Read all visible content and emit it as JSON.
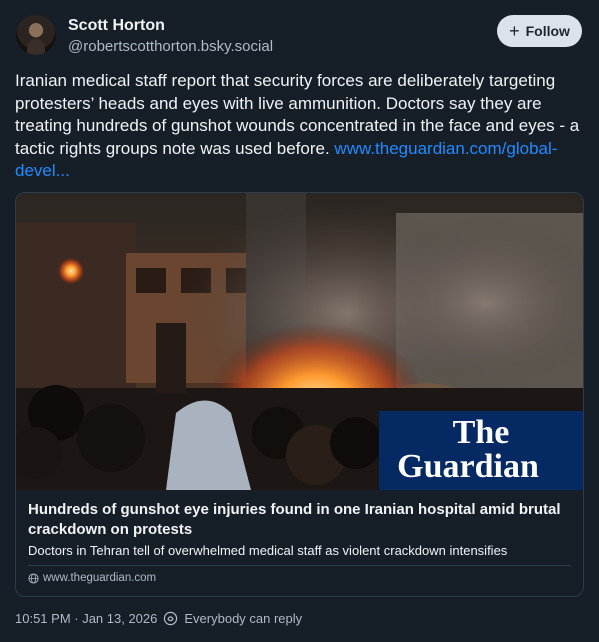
{
  "author": {
    "display_name": "Scott Horton",
    "handle": "@robertscotthorton.bsky.social"
  },
  "follow_button": {
    "label": "Follow",
    "icon": "plus-icon"
  },
  "post": {
    "text": "Iranian medical staff report that security forces are deliberately targeting protesters’ heads and eyes with live ammunition. Doctors say they are treating hundreds of gunshot wounds concentrated in the face and eyes - a tactic rights groups note was used before.",
    "link_text": "www.theguardian.com/global-devel..."
  },
  "link_card": {
    "image_logo_line1": "The",
    "image_logo_line2": "Guardian",
    "title": "Hundreds of gunshot eye injuries found in one Iranian hospital amid brutal crackdown on protests",
    "description": "Doctors in Tehran tell of overwhelmed medical staff as violent crackdown intensifies",
    "domain": "www.theguardian.com",
    "domain_icon": "globe-icon"
  },
  "meta": {
    "timestamp": "10:51 PM · Jan 13, 2026",
    "reply_setting": "Everybody can reply",
    "reply_icon": "reply-settings-icon"
  }
}
